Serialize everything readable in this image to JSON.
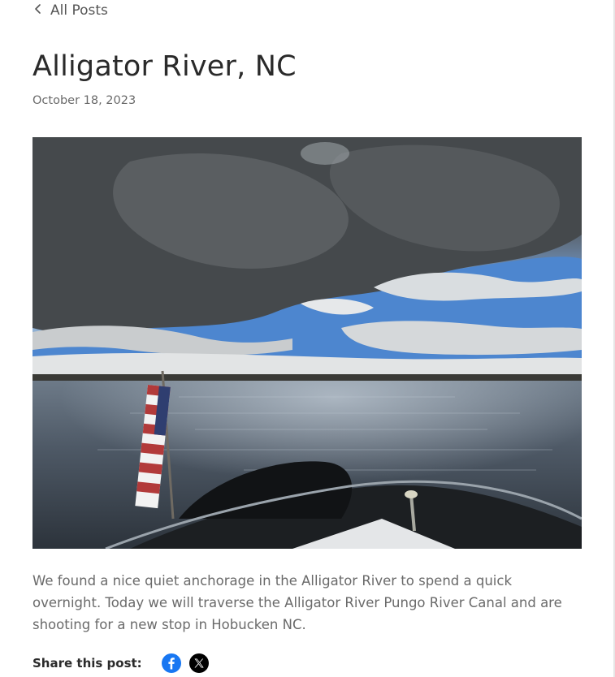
{
  "nav": {
    "back_label": "All Posts",
    "back_icon": "chevron-left-icon"
  },
  "post": {
    "title": "Alligator River, NC",
    "date": "October 18, 2023",
    "image": {
      "subject": "Cloudy sky over the Alligator River with American flag on a boat stern",
      "icon": "photo"
    },
    "body": "We found a nice quiet anchorage in the Alligator River to spend a quick overnight. Today we will traverse the Alligator River Pungo River Canal and are shooting for a new stop in Hobucken NC."
  },
  "share": {
    "label": "Share this post:",
    "icons": [
      "facebook-icon",
      "x-icon"
    ],
    "colors": {
      "facebook": "#1877F2",
      "x": "#000000"
    }
  }
}
